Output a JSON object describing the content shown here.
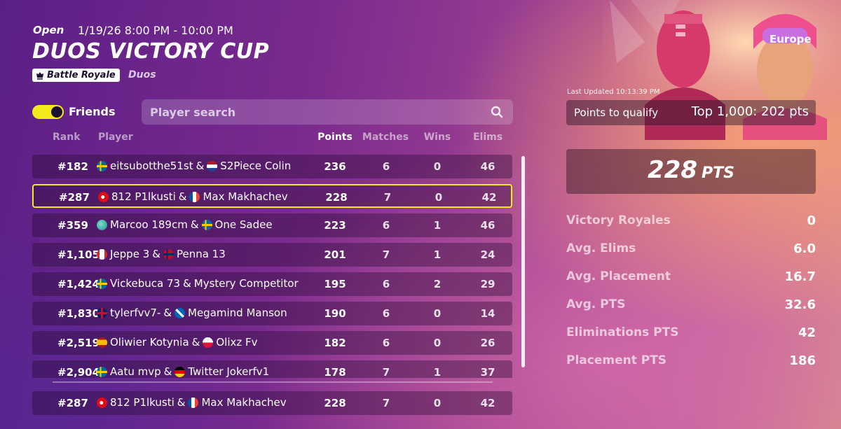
{
  "event": {
    "status": "Open",
    "time": "1/19/26 8:00 PM - 10:00 PM",
    "title": "DUOS VICTORY CUP",
    "mode": "Battle Royale",
    "team_type": "Duos"
  },
  "filters": {
    "friends_label": "Friends",
    "friends_on": true,
    "search_placeholder": "Player search"
  },
  "columns": {
    "rank": "Rank",
    "player": "Player",
    "points": "Points",
    "matches": "Matches",
    "wins": "Wins",
    "elims": "Elims"
  },
  "rows": [
    {
      "rank": "#182",
      "p1": "eitsubotthe51st",
      "p2": "S2Piece Colin",
      "f1": "se",
      "f2": "nl",
      "points": "236",
      "matches": "6",
      "wins": "0",
      "elims": "46"
    },
    {
      "rank": "#287",
      "p1": "812 P1lkusti",
      "p2": "Max Makhachev",
      "f1": "tr",
      "f2": "fr",
      "points": "228",
      "matches": "7",
      "wins": "0",
      "elims": "42",
      "selected": true
    },
    {
      "rank": "#359",
      "p1": "Marcoo 189cm",
      "p2": "One Sadee",
      "f1": "globe",
      "f2": "se",
      "points": "223",
      "matches": "6",
      "wins": "1",
      "elims": "46"
    },
    {
      "rank": "#1,105",
      "p1": "Jeppe 3",
      "p2": "Penna 13",
      "f1": "ca",
      "f2": "no",
      "points": "201",
      "matches": "7",
      "wins": "1",
      "elims": "24"
    },
    {
      "rank": "#1,424",
      "p1": "Vickebuca 73",
      "p2": "Mystery Competitor",
      "f1": "se",
      "f2": "",
      "points": "195",
      "matches": "6",
      "wins": "2",
      "elims": "29"
    },
    {
      "rank": "#1,830",
      "p1": "tylerfvv7-",
      "p2": "Megamind Manson",
      "f1": "gb",
      "f2": "sco",
      "points": "190",
      "matches": "6",
      "wins": "0",
      "elims": "14"
    },
    {
      "rank": "#2,519",
      "p1": "Oliwier Kotynia",
      "p2": "Olixz Fv",
      "f1": "es",
      "f2": "pl",
      "points": "182",
      "matches": "6",
      "wins": "0",
      "elims": "26"
    },
    {
      "rank": "#2,904",
      "p1": "Aatu mvp",
      "p2": "Twitter Jokerfv1",
      "f1": "se",
      "f2": "de",
      "points": "178",
      "matches": "7",
      "wins": "1",
      "elims": "37"
    }
  ],
  "pinned_row": {
    "rank": "#287",
    "p1": "812 P1lkusti",
    "p2": "Max Makhachev",
    "f1": "tr",
    "f2": "fr",
    "points": "228",
    "matches": "7",
    "wins": "0",
    "elims": "42"
  },
  "amp": "&",
  "stats_panel": {
    "region": "Europe",
    "last_updated": "Last Updated 10:13:39 PM",
    "qualify_label": "Points to qualify",
    "qualify_value": "Top 1,000: 202 pts",
    "total_points": "228",
    "total_unit": "PTS",
    "stats": [
      {
        "label": "Victory Royales",
        "value": "0"
      },
      {
        "label": "Avg. Elims",
        "value": "6.0"
      },
      {
        "label": "Avg. Placement",
        "value": "16.7"
      },
      {
        "label": "Avg. PTS",
        "value": "32.6"
      },
      {
        "label": "Eliminations PTS",
        "value": "42"
      },
      {
        "label": "Placement PTS",
        "value": "186"
      }
    ]
  },
  "colors": {
    "accent_yellow": "#f2ea1d",
    "row_bg": "rgba(40,10,50,0.38)"
  },
  "icons": {
    "mode": "crown-icon",
    "search": "search-icon"
  }
}
